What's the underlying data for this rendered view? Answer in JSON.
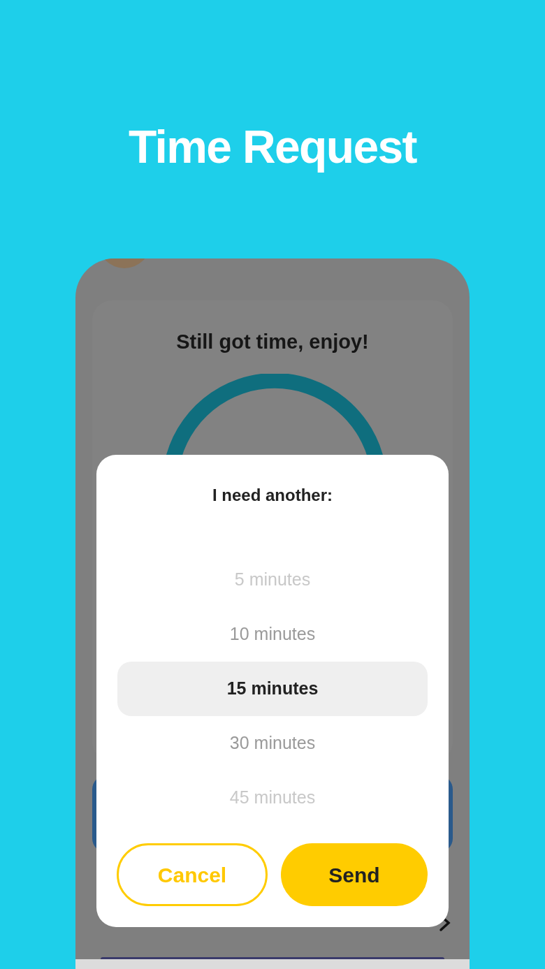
{
  "headline": "Time Request",
  "card": {
    "message": "Still got time, enjoy!"
  },
  "dialog": {
    "title": "I need another:",
    "options": [
      {
        "label": "5 minutes",
        "selected": false
      },
      {
        "label": "10 minutes",
        "selected": false
      },
      {
        "label": "15 minutes",
        "selected": true
      },
      {
        "label": "30 minutes",
        "selected": false
      },
      {
        "label": "45 minutes",
        "selected": false
      }
    ],
    "buttons": [
      {
        "label": "Cancel",
        "kind": "outline"
      },
      {
        "label": "Send",
        "kind": "filled"
      }
    ]
  }
}
